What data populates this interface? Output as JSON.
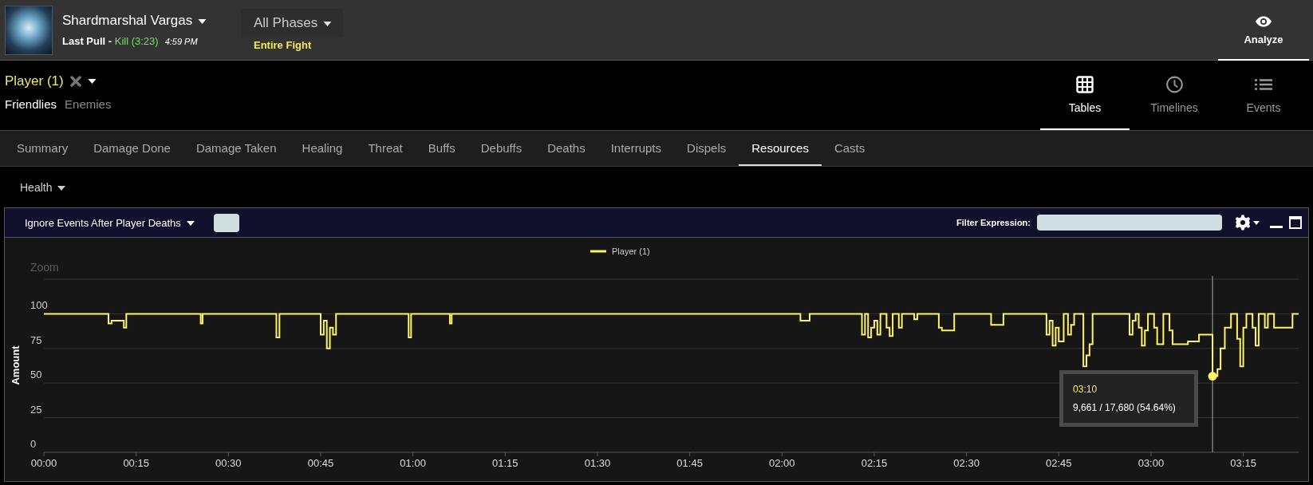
{
  "header": {
    "boss_name": "Shardmarshal Vargas",
    "pull_label": "Last Pull - ",
    "result": "Kill (3:23)",
    "time": "4:59 PM",
    "phase": "All Phases",
    "phase_subtitle": "Entire Fight",
    "analyze": {
      "label": "Analyze",
      "selected": true
    }
  },
  "player_filter": {
    "label": "Player (1)",
    "groups": [
      {
        "label": "Friendlies",
        "selected": true
      },
      {
        "label": "Enemies",
        "selected": false
      }
    ]
  },
  "views": [
    {
      "label": "Tables",
      "kind": "grid",
      "selected": true
    },
    {
      "label": "Timelines",
      "kind": "clock",
      "selected": false
    },
    {
      "label": "Events",
      "kind": "list",
      "selected": false
    }
  ],
  "tabs": [
    {
      "label": "Summary",
      "selected": false
    },
    {
      "label": "Damage Done",
      "selected": false
    },
    {
      "label": "Damage Taken",
      "selected": false
    },
    {
      "label": "Healing",
      "selected": false
    },
    {
      "label": "Threat",
      "selected": false
    },
    {
      "label": "Buffs",
      "selected": false
    },
    {
      "label": "Debuffs",
      "selected": false
    },
    {
      "label": "Deaths",
      "selected": false
    },
    {
      "label": "Interrupts",
      "selected": false
    },
    {
      "label": "Dispels",
      "selected": false
    },
    {
      "label": "Resources",
      "selected": true
    },
    {
      "label": "Casts",
      "selected": false
    }
  ],
  "resource_select": "Health",
  "panel": {
    "death_filter": "Ignore Events After Player Deaths",
    "filter_label": "Filter Expression:",
    "zoom_label": "Zoom",
    "chart_data": {
      "type": "line",
      "ylabel": "Amount",
      "xlim": [
        0,
        204
      ],
      "ylim": [
        0,
        125
      ],
      "grid": true,
      "ref_lines": [
        {
          "axis": "x",
          "value": 190
        }
      ],
      "xticks": [
        {
          "value": 0,
          "label": "00:00"
        },
        {
          "value": 15,
          "label": "00:15"
        },
        {
          "value": 30,
          "label": "00:30"
        },
        {
          "value": 45,
          "label": "00:45"
        },
        {
          "value": 60,
          "label": "01:00"
        },
        {
          "value": 75,
          "label": "01:15"
        },
        {
          "value": 90,
          "label": "01:30"
        },
        {
          "value": 105,
          "label": "01:45"
        },
        {
          "value": 120,
          "label": "02:00"
        },
        {
          "value": 135,
          "label": "02:15"
        },
        {
          "value": 150,
          "label": "02:30"
        },
        {
          "value": 165,
          "label": "02:45"
        },
        {
          "value": 180,
          "label": "03:00"
        },
        {
          "value": 195,
          "label": "03:15"
        }
      ],
      "yticks": [
        0,
        25,
        50,
        75,
        100
      ],
      "x": [
        0,
        10.5,
        10.5,
        11,
        11,
        13,
        13,
        13.4,
        13.4,
        25.5,
        25.5,
        25.8,
        25.8,
        37.8,
        37.8,
        38.3,
        38.3,
        45,
        45,
        45.5,
        45.5,
        46,
        46,
        46.5,
        46.5,
        47,
        47,
        47.5,
        47.5,
        59.3,
        59.3,
        59.7,
        59.7,
        66,
        66,
        66.3,
        66.3,
        123,
        123,
        124.5,
        124.5,
        133,
        133,
        133.5,
        133.5,
        134,
        134,
        134.5,
        134.5,
        135,
        135,
        135.5,
        135.5,
        136,
        136,
        137,
        137,
        137.5,
        137.5,
        138,
        138,
        139,
        139,
        139.5,
        139.5,
        141.5,
        141.5,
        142,
        142,
        145.5,
        145.5,
        146,
        146,
        148,
        148,
        154,
        154,
        156,
        156,
        163,
        163,
        163.5,
        163.5,
        164,
        164,
        164.5,
        164.5,
        165,
        165,
        165.8,
        165.8,
        166.5,
        166.5,
        167,
        167,
        167.5,
        167.5,
        169,
        169,
        169.5,
        169.5,
        170,
        170,
        170.5,
        170.5,
        176.5,
        176.5,
        177,
        177,
        177.5,
        177.5,
        178,
        178,
        178.5,
        178.5,
        179,
        179,
        179.5,
        179.5,
        180.5,
        180.5,
        181,
        181,
        182,
        182,
        183,
        183,
        183.5,
        183.5,
        186,
        186,
        187.8,
        187.8,
        190,
        190,
        190.8,
        190.8,
        191.3,
        191.3,
        192,
        192,
        193,
        193,
        194,
        194,
        194.5,
        194.5,
        195,
        195,
        195.5,
        195.5,
        196.5,
        196.5,
        197,
        197,
        197.5,
        197.5,
        198.5,
        198.5,
        199,
        199,
        200,
        200,
        203,
        203,
        204
      ],
      "series": [
        {
          "name": "Player (1)",
          "color": "#fff45f",
          "values": [
            100,
            100,
            93,
            93,
            95,
            95,
            90,
            90,
            100,
            100,
            93,
            93,
            100,
            100,
            83,
            83,
            100,
            100,
            85,
            85,
            95,
            95,
            75,
            75,
            90,
            90,
            85,
            85,
            100,
            100,
            83,
            83,
            100,
            100,
            93,
            93,
            100,
            100,
            95,
            95,
            100,
            100,
            85,
            85,
            100,
            100,
            83,
            83,
            90,
            90,
            95,
            95,
            85,
            85,
            100,
            100,
            90,
            90,
            84,
            84,
            100,
            100,
            90,
            90,
            100,
            100,
            96,
            96,
            100,
            100,
            90,
            90,
            88,
            88,
            100,
            100,
            92,
            92,
            100,
            100,
            85,
            85,
            95,
            95,
            77,
            77,
            90,
            90,
            80,
            80,
            100,
            100,
            85,
            85,
            92,
            92,
            100,
            100,
            62,
            62,
            70,
            70,
            78,
            78,
            100,
            100,
            85,
            85,
            95,
            95,
            100,
            100,
            90,
            90,
            77,
            77,
            88,
            88,
            100,
            100,
            90,
            90,
            78,
            78,
            100,
            100,
            88,
            88,
            78,
            78,
            80,
            80,
            85,
            85,
            55,
            55,
            60,
            60,
            75,
            75,
            90,
            90,
            100,
            100,
            82,
            82,
            62,
            62,
            90,
            90,
            100,
            100,
            90,
            90,
            77,
            77,
            100,
            100,
            90,
            90,
            100,
            100,
            90,
            90,
            100,
            100
          ]
        }
      ]
    },
    "tooltip": {
      "time": "03:10",
      "value": "9,661 / 17,680 (54.64%)"
    }
  }
}
